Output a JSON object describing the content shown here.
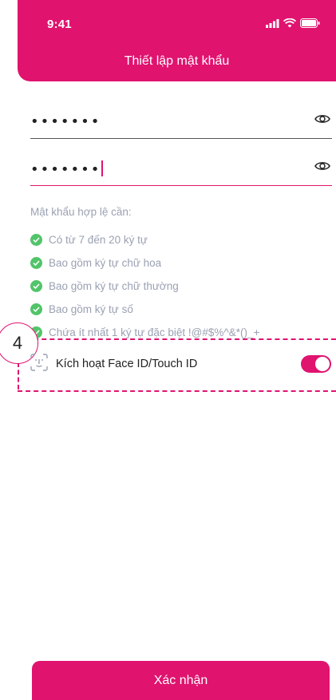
{
  "status_bar": {
    "time": "9:41"
  },
  "header": {
    "title": "Thiết lập mật khẩu"
  },
  "password": {
    "value_masked": "•••••••",
    "confirm_masked": "•••••••"
  },
  "requirements": {
    "title": "Mật khẩu hợp lệ cần:",
    "items": [
      "Có từ 7 đến 20 ký tự",
      "Bao gồm ký tự chữ hoa",
      "Bao gồm ký tự chữ thường",
      "Bao gồm ký tự số",
      "Chứa ít nhất 1 ký tự đặc biệt !@#$%^&*()_+"
    ]
  },
  "annotation": {
    "step_number": "4"
  },
  "biometric": {
    "label": "Kích hoạt Face ID/Touch ID",
    "enabled": true
  },
  "footer": {
    "confirm_label": "Xác nhận"
  },
  "colors": {
    "primary": "#e0136f",
    "success": "#52c46a",
    "muted_text": "#9aa1b2"
  },
  "icons": [
    "signal-icon",
    "wifi-icon",
    "battery-icon",
    "eye-icon",
    "check-circle-icon",
    "face-id-icon"
  ]
}
